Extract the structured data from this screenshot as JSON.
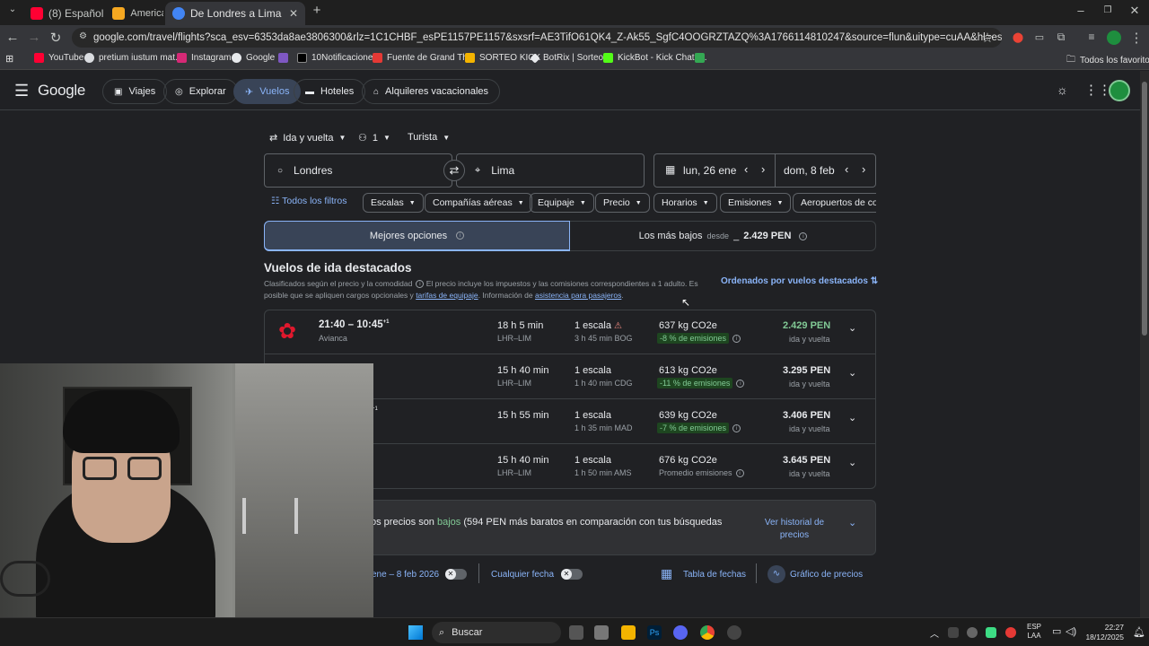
{
  "browser": {
    "tabs": [
      {
        "label": "(8) Español",
        "active": false
      },
      {
        "label": "Americana: Reto",
        "active": false
      },
      {
        "label": "De Londres a Lima | Google Vu",
        "active": true
      }
    ],
    "url": "google.com/travel/flights?sca_esv=6353da8ae3806300&rlz=1C1CHBF_esPE1157PE1157&sxsrf=AE3TifO61QK4_Z-Ak55_SgfC4OOGRZTAZQ%3A1766114810247&source=flun&uitype=cuAA&hl=es&gl=pe&curr=PEN&tfs=CAEQAhooEgoy...",
    "bookmarks": [
      "YouTube",
      "pretium iustum mat...",
      "Instagram",
      "Google",
      "10Notificaciones",
      "Fuente de Grand Th...",
      "SORTEO KICK",
      "BotRix | Sorteos",
      "KickBot - Kick Chatb...",
      "Todos los favoritos"
    ]
  },
  "header": {
    "logo": "Google",
    "nav": [
      "Viajes",
      "Explorar",
      "Vuelos",
      "Hoteles",
      "Alquileres vacacionales"
    ]
  },
  "search": {
    "trip_type": "Ida y vuelta",
    "passengers": "1",
    "cabin": "Turista",
    "origin": "Londres",
    "destination": "Lima",
    "depart": "lun, 26 ene",
    "return": "dom, 8 feb"
  },
  "filters": [
    "Todos los filtros",
    "Escalas",
    "Compañías aéreas",
    "Equipaje",
    "Precio",
    "Horarios",
    "Emisiones",
    "Aeropuertos de cor"
  ],
  "sort_tabs": {
    "best": "Mejores opciones",
    "cheapest": "Los más bajos",
    "cheapest_from": "desde",
    "cheapest_price": "2.429 PEN"
  },
  "results": {
    "title": "Vuelos de ida destacados",
    "note_1": "Clasificados según el precio y la comodidad",
    "note_2": "El precio incluye los impuestos y las comisiones correspondientes a 1 adulto. Es",
    "note_3": "posible que se apliquen cargos opcionales y",
    "note_link1": "tarifas de equipaje",
    "note_4": ". Información de",
    "note_link2": "asistencia para pasajeros",
    "sort_label": "Ordenados por vuelos destacados",
    "flights": [
      {
        "times": "21:40 – 10:45",
        "plus": "+1",
        "airline": "Avianca",
        "duration": "18 h 5 min",
        "route": "LHR–LIM",
        "stops": "1 escala",
        "layover": "3 h 45 min BOG",
        "co2": "637 kg CO2e",
        "emissions": "-8 % de emisiones",
        "price": "2.429 PEN",
        "price_note": "ida y vuelta",
        "highlight": true
      },
      {
        "times": "",
        "plus": "",
        "airline": "",
        "duration": "15 h 40 min",
        "route": "LHR–LIM",
        "stops": "1 escala",
        "layover": "1 h 40 min CDG",
        "co2": "613 kg CO2e",
        "emissions": "-11 % de emisiones",
        "price": "3.295 PEN",
        "price_note": "ida y vuelta",
        "highlight": false
      },
      {
        "times": "",
        "plus": "+1",
        "airline": "",
        "duration": "15 h 55 min",
        "route": "",
        "stops": "1 escala",
        "layover": "1 h 35 min MAD",
        "co2": "639 kg CO2e",
        "emissions": "-7 % de emisiones",
        "price": "3.406 PEN",
        "price_note": "ida y vuelta",
        "highlight": false
      },
      {
        "times": "",
        "plus": "",
        "airline": "",
        "duration": "15 h 40 min",
        "route": "LHR–LIM",
        "stops": "1 escala",
        "layover": "1 h 50 min AMS",
        "co2": "676 kg CO2e",
        "emissions": "Promedio emisiones",
        "price": "3.645 PEN",
        "price_note": "ida y vuelta",
        "highlight": false
      }
    ]
  },
  "insight": {
    "text_1": "os precios son",
    "text_bajos": "bajos",
    "text_2": "(594 PEN más baratos en comparación con tus búsquedas",
    "history": "Ver historial de precios"
  },
  "bottom": {
    "dates": "ene – 8 feb 2026",
    "any_date": "Cualquier fecha",
    "table": "Tabla de fechas",
    "graph": "Gráfico de precios"
  },
  "taskbar": {
    "search": "Buscar",
    "lang_1": "ESP",
    "lang_2": "LAA",
    "time": "22:27",
    "date": "18/12/2025"
  },
  "colors": {
    "accent": "#8ab4f8",
    "price_green": "#81c995",
    "avianca_red": "#e0182d"
  }
}
